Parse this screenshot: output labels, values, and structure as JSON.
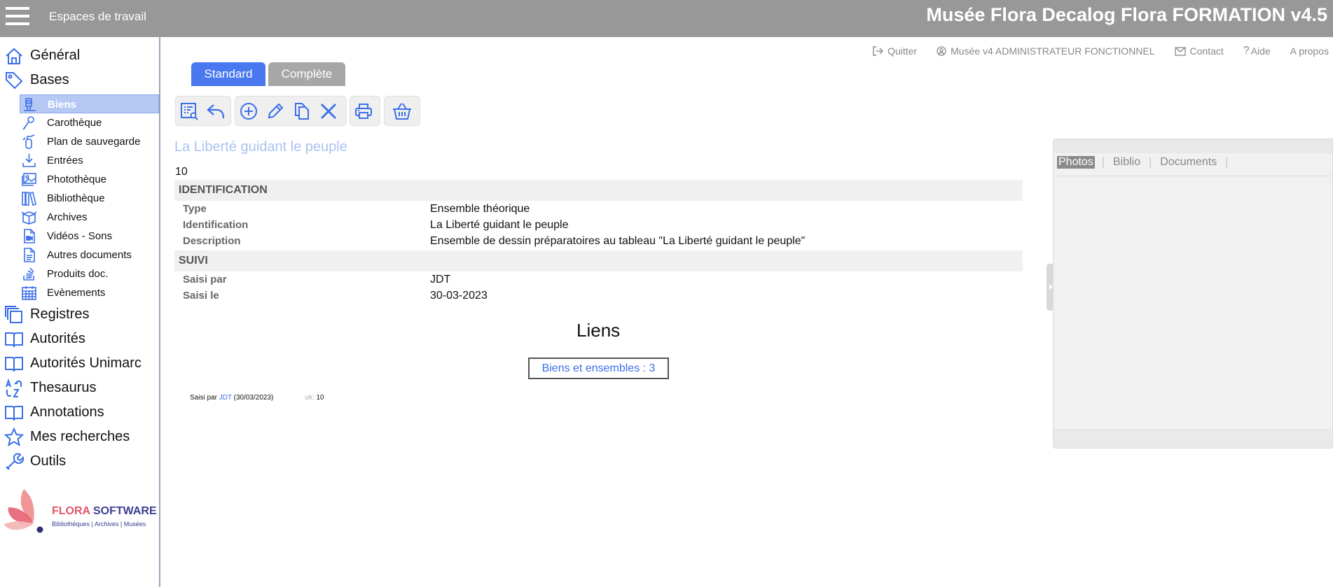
{
  "header": {
    "workspaces_label": "Espaces de travail",
    "app_title": "Musée Flora Decalog Flora FORMATION v4.5"
  },
  "sidebar": {
    "main": [
      {
        "label": "Général",
        "icon": "home-icon"
      },
      {
        "label": "Bases",
        "icon": "tag-icon"
      },
      {
        "label": "Registres",
        "icon": "stack-icon"
      },
      {
        "label": "Autorités",
        "icon": "book-icon"
      },
      {
        "label": "Autorités Unimarc",
        "icon": "book-icon"
      },
      {
        "label": "Thesaurus",
        "icon": "sort-az-icon"
      },
      {
        "label": "Annotations",
        "icon": "book-icon"
      },
      {
        "label": "Mes recherches",
        "icon": "star-icon"
      },
      {
        "label": "Outils",
        "icon": "wrench-icon"
      }
    ],
    "sub": [
      {
        "label": "Biens",
        "icon": "object-icon"
      },
      {
        "label": "Carothèque",
        "icon": "pin-icon"
      },
      {
        "label": "Plan de sauvegarde",
        "icon": "extinguisher-icon"
      },
      {
        "label": "Entrées",
        "icon": "download-icon"
      },
      {
        "label": "Photothèque",
        "icon": "image-icon"
      },
      {
        "label": "Bibliothèque",
        "icon": "books-icon"
      },
      {
        "label": "Archives",
        "icon": "box-icon"
      },
      {
        "label": "Vidéos - Sons",
        "icon": "video-file-icon"
      },
      {
        "label": "Autres documents",
        "icon": "document-icon"
      },
      {
        "label": "Produits doc.",
        "icon": "stack-overflow-icon"
      },
      {
        "label": "Evènements",
        "icon": "calendar-icon"
      }
    ],
    "logo": {
      "brand_a": "FLORA",
      "brand_b": " SOFTWARE",
      "tagline": "Bibliothèques | Archives | Musées"
    }
  },
  "toplinks": {
    "quit": "Quitter",
    "user": "Musée v4 ADMINISTRATEUR FONCTIONNEL",
    "contact": "Contact",
    "help": "Aide",
    "about": "A propos"
  },
  "tabs": {
    "standard": "Standard",
    "complete": "Complète"
  },
  "record": {
    "title": "La Liberté guidant le peuple",
    "number": "10",
    "sections": [
      {
        "label": "IDENTIFICATION",
        "fields": [
          {
            "key": "Type",
            "value": "Ensemble théorique"
          },
          {
            "key": "Identification",
            "value": "La Liberté guidant le peuple"
          },
          {
            "key": "Description",
            "value": "Ensemble de dessin préparatoires au tableau \"La Liberté guidant le peuple\""
          }
        ]
      },
      {
        "label": "SUIVI",
        "fields": [
          {
            "key": "Saisi par",
            "value": "JDT"
          },
          {
            "key": "Saisi le",
            "value": "30-03-2023"
          }
        ]
      }
    ],
    "liens_title": "Liens",
    "liens_button": "Biens et ensembles : 3",
    "footer": {
      "prefix": "Saisi par ",
      "user": "JDT",
      "date": " (30/03/2023)",
      "uk_label": "uk:",
      "uk_value": " 10"
    }
  },
  "panel": {
    "tabs": [
      "Photos",
      "Biblio",
      "Documents"
    ]
  },
  "colors": {
    "accent": "#4a78f0",
    "topbar": "#989898",
    "tab_inactive": "#a7a7a7",
    "title_light": "#a9c3f2"
  }
}
